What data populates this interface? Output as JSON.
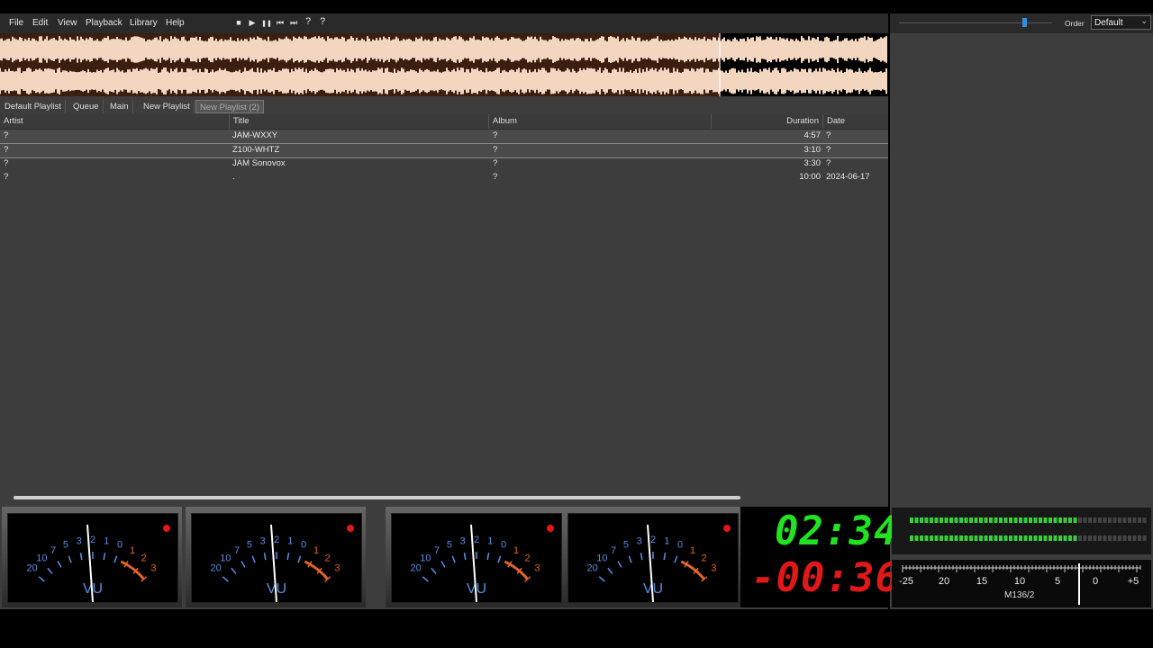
{
  "menu": [
    "File",
    "Edit",
    "View",
    "Playback",
    "Library",
    "Help"
  ],
  "toolbar": {
    "stop": "■",
    "play": "▶",
    "pause": "❚❚",
    "prev": "⏮",
    "next": "⏭",
    "random": "?",
    "random2": "?"
  },
  "right_top": {
    "order_label": "Order",
    "order_value": "Default",
    "volume_level": 0.82
  },
  "tabs": [
    "Default Playlist",
    "Queue",
    "Main",
    "New Playlist",
    "New Playlist (2)"
  ],
  "columns": {
    "artist": "Artist",
    "title": "Title",
    "album": "Album",
    "duration": "Duration",
    "date": "Date"
  },
  "rows": [
    {
      "artist": "?",
      "title": "JAM-WXXY",
      "album": "?",
      "duration": "4:57",
      "date": "?"
    },
    {
      "artist": "?",
      "title": "Z100-WHTZ",
      "album": "?",
      "duration": "3:10",
      "date": "?"
    },
    {
      "artist": "?",
      "title": "JAM Sonovox",
      "album": "?",
      "duration": "3:30",
      "date": "?"
    },
    {
      "artist": "?",
      "title": ".",
      "album": "?",
      "duration": "10:00",
      "date": "2024-06-17"
    }
  ],
  "playback_progress": 0.81,
  "vu": {
    "label": "VU",
    "scale": [
      "20",
      "10",
      "7",
      "5",
      "3",
      "2",
      "1",
      "0",
      "1",
      "2",
      "3"
    ]
  },
  "clock": {
    "elapsed": "02:34",
    "remaining": "-00:36"
  },
  "ppm": {
    "scale": [
      "-25",
      "20",
      "15",
      "10",
      "5",
      "0",
      "+5"
    ],
    "model": "M136/2"
  },
  "colors": {
    "elapsed": "#22e022",
    "remaining": "#e01818",
    "wave": "#f3d6c0",
    "meter_green": "#35d03a"
  }
}
